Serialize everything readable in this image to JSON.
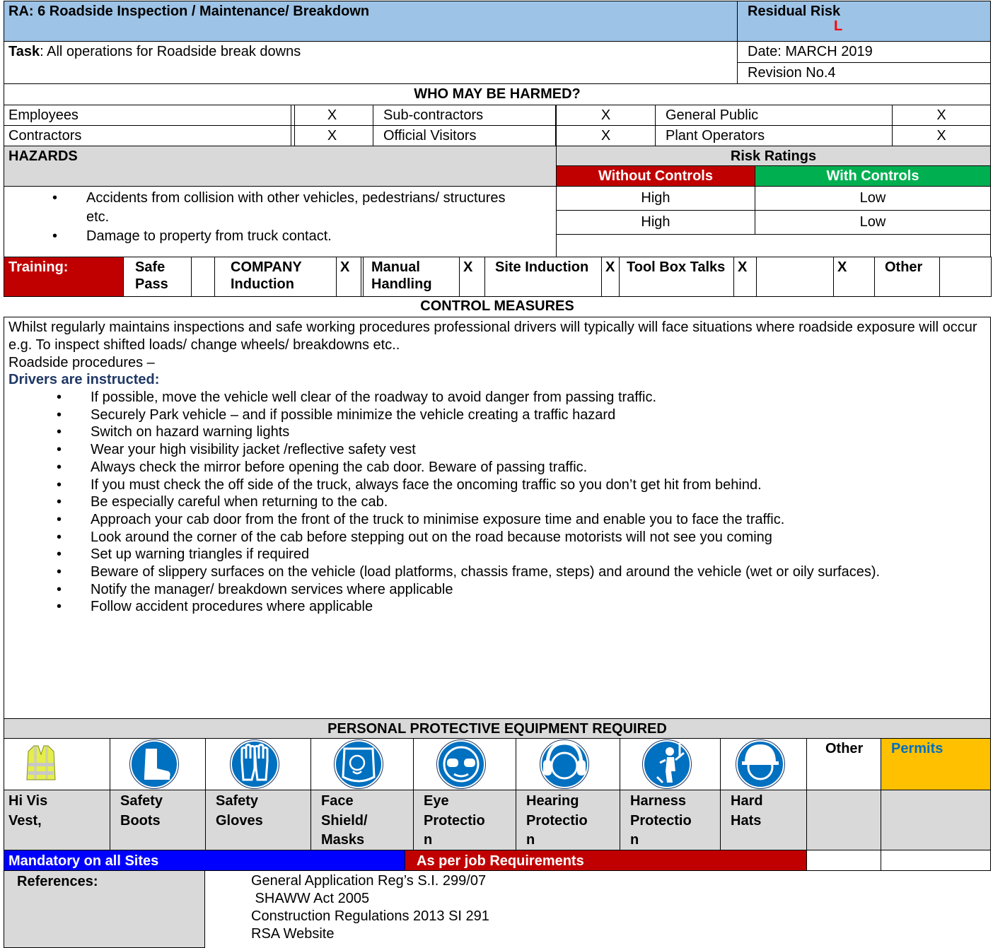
{
  "header": {
    "title": "RA: 6 Roadside Inspection / Maintenance/ Breakdown",
    "residual_label": "Residual Risk",
    "residual_value": "L",
    "task_label": "Task",
    "task_text": ": All operations for Roadside break downs",
    "date": "Date: MARCH 2019",
    "revision": "Revision No.4"
  },
  "who": {
    "title": "WHO MAY BE HARMED?",
    "rows": [
      [
        {
          "label": "Employees",
          "mark": "X"
        },
        {
          "label": "Sub-contractors",
          "mark": "X"
        },
        {
          "label": "General Public",
          "mark": "X"
        }
      ],
      [
        {
          "label": "Contractors",
          "mark": "X"
        },
        {
          "label": "Official Visitors",
          "mark": "X"
        },
        {
          "label": "Plant Operators",
          "mark": "X"
        }
      ]
    ]
  },
  "hazards": {
    "title": "HAZARDS",
    "risk_title": "Risk Ratings",
    "without_label": "Without Controls",
    "with_label": "With Controls",
    "items": [
      "Accidents from collision with other vehicles, pedestrians/ structures etc.",
      "Damage to property from truck contact."
    ],
    "ratings": [
      {
        "without": "High",
        "with": "Low"
      },
      {
        "without": "High",
        "with": "Low"
      }
    ]
  },
  "training": {
    "label": "Training:",
    "cells": [
      {
        "text": "Safe Pass",
        "mark": ""
      },
      {
        "text": "COMPANY Induction",
        "mark": "X"
      },
      {
        "text": "Manual Handling",
        "mark": "X"
      },
      {
        "text": "Site Induction",
        "mark": "X"
      },
      {
        "text": "Tool Box Talks",
        "mark": "X"
      },
      {
        "text": "",
        "mark": "X"
      },
      {
        "text": "Other",
        "mark": ""
      }
    ]
  },
  "control": {
    "title": "CONTROL MEASURES",
    "intro": "Whilst regularly maintains inspections and safe working procedures professional drivers will typically will face situations where roadside exposure will occur e.g. To inspect shifted loads/ change wheels/ breakdowns etc..",
    "procedures": "Roadside procedures –",
    "instructed": "Drivers are instructed:",
    "items": [
      "If possible, move the vehicle well clear of the roadway to avoid danger from passing traffic.",
      "Securely Park vehicle – and if possible minimize the vehicle creating a traffic hazard",
      "Switch on hazard warning lights",
      "Wear your high visibility jacket  /reflective safety vest",
      "Always check the mirror before opening the cab door. Beware of passing traffic.",
      "If you must check the off side of the truck, always face the oncoming traffic so you don’t get hit from behind.",
      "Be especially careful when returning to the cab.",
      "Approach your cab door from the front of the truck to minimise exposure time and enable you to face the traffic.",
      "Look around the corner of the cab before stepping out on the road because motorists will not see you coming",
      "Set up warning triangles if required",
      "Beware of slippery surfaces on the vehicle (load platforms, chassis frame, steps) and around the vehicle (wet or oily surfaces).",
      "Notify the manager/ breakdown services where applicable",
      "Follow accident procedures where applicable"
    ]
  },
  "ppe": {
    "title": "PERSONAL PROTECTIVE EQUIPMENT REQUIRED",
    "other_label": "Other",
    "permits_label": "Permits",
    "labels": [
      "Hi Vis\nVest,",
      "Safety\nBoots",
      "Safety\nGloves",
      "Face\nShield/\nMasks",
      "Eye\nProtectio\nn",
      "Hearing\nProtectio\nn",
      "Harness\nProtectio\nn",
      "Hard\nHats"
    ],
    "icons": [
      "hi-vis-vest-icon",
      "safety-boots-icon",
      "safety-gloves-icon",
      "face-shield-icon",
      "eye-protection-icon",
      "hearing-protection-icon",
      "harness-icon",
      "hard-hat-icon"
    ],
    "mandatory_label": "Mandatory on all Sites",
    "job_label": "As per job Requirements"
  },
  "references": {
    "label": "References:",
    "items": [
      "General Application Reg’s S.I. 299/07",
      " SHAWW Act 2005",
      "Construction Regulations 2013 SI 291",
      "RSA Website"
    ]
  },
  "colors": {
    "header_blue": "#9dc3e6",
    "grey": "#d9d9d9",
    "red": "#c00000",
    "green": "#00b050",
    "navy_text": "#1f3864",
    "sign_blue": "#0070c0",
    "permits_orange": "#ffc000",
    "mandatory_blue": "#0000ff"
  }
}
